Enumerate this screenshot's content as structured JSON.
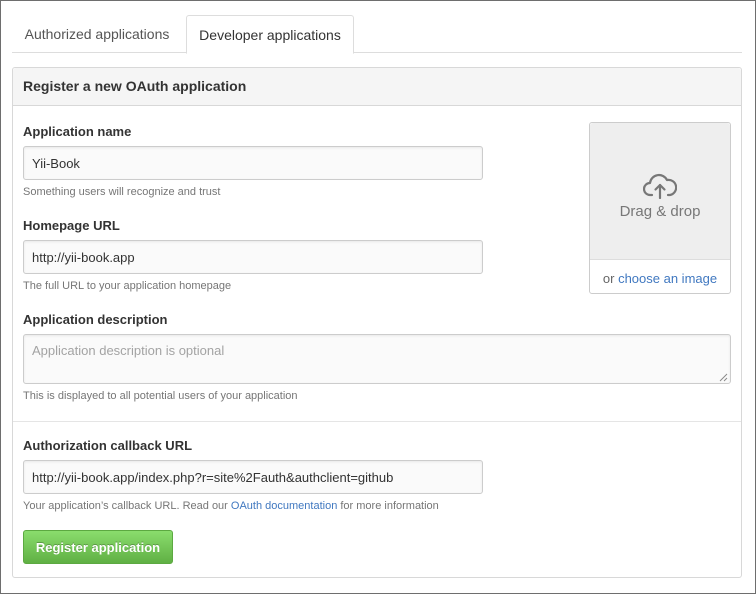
{
  "tabs": [
    {
      "label": "Authorized applications",
      "active": false
    },
    {
      "label": "Developer applications",
      "active": true
    }
  ],
  "panel": {
    "title": "Register a new OAuth application"
  },
  "form": {
    "app_name": {
      "label": "Application name",
      "value": "Yii-Book",
      "note": "Something users will recognize and trust"
    },
    "homepage": {
      "label": "Homepage URL",
      "value": "http://yii-book.app",
      "note": "The full URL to your application homepage"
    },
    "description": {
      "label": "Application description",
      "placeholder": "Application description is optional",
      "note": "This is displayed to all potential users of your application"
    },
    "callback": {
      "label": "Authorization callback URL",
      "value": "http://yii-book.app/index.php?r=site%2Fauth&authclient=github",
      "note_prefix": "Your application’s callback URL. Read our ",
      "note_link": "OAuth documentation",
      "note_suffix": " for more information"
    },
    "submit_label": "Register application"
  },
  "logo_upload": {
    "icon": "cloud-upload-icon",
    "drop_text": "Drag & drop",
    "or_text": "or ",
    "choose_link": "choose an image"
  },
  "colors": {
    "link": "#4078c0",
    "button_green": "#60b044"
  }
}
